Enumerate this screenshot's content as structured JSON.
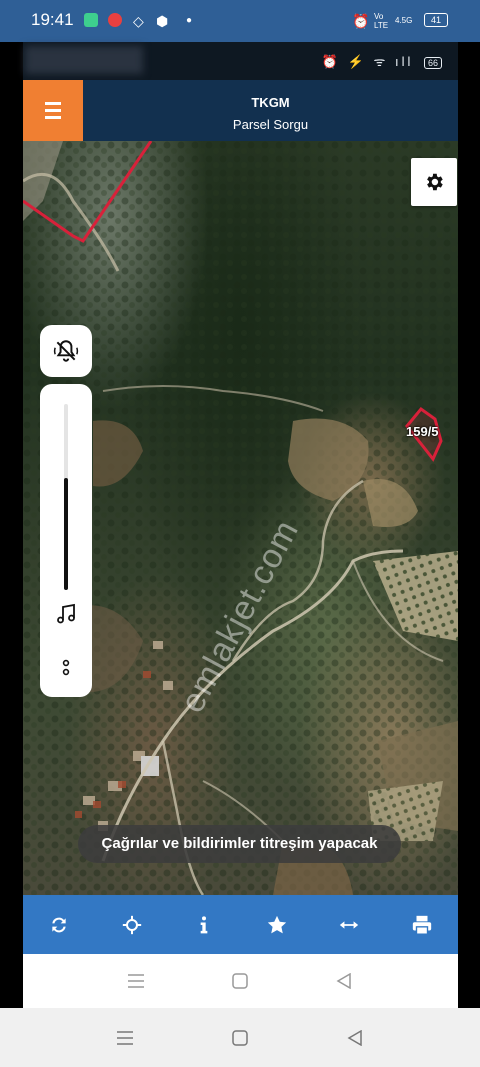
{
  "status_bar": {
    "time": "19:41",
    "network": "4.5G",
    "volte": "Vo LTE",
    "battery": "41"
  },
  "inner_status": {
    "icons": "⏰ ⚡ ᯤ ıll",
    "battery": "66"
  },
  "app": {
    "title": "TKGM",
    "subtitle": "Parsel Sorgu",
    "menu_icon": "hamburger-icon",
    "settings_icon": "gear-icon"
  },
  "map": {
    "parcel_label": "159/5",
    "watermark": "emlakjet.com",
    "parcel_color": "#d8213a"
  },
  "volume": {
    "mute_icon": "bell-off-icon",
    "music_icon": "music-note-icon",
    "more_icon": "more-vertical-icon",
    "level": 0.6
  },
  "toast": {
    "text": "Çağrılar ve bildirimler titreşim yapacak"
  },
  "toolbar": {
    "buttons": [
      {
        "icon": "refresh-icon"
      },
      {
        "icon": "crosshair-icon"
      },
      {
        "icon": "info-icon"
      },
      {
        "icon": "star-icon"
      },
      {
        "icon": "measure-icon"
      },
      {
        "icon": "print-icon"
      }
    ],
    "color": "#3378c4"
  },
  "nav": {
    "menu_icon": "recent-apps-icon",
    "home_icon": "home-icon",
    "back_icon": "back-icon"
  },
  "colors": {
    "header": "#12304f",
    "menu_accent": "#f07f32",
    "status_bar": "#2f5f96"
  }
}
